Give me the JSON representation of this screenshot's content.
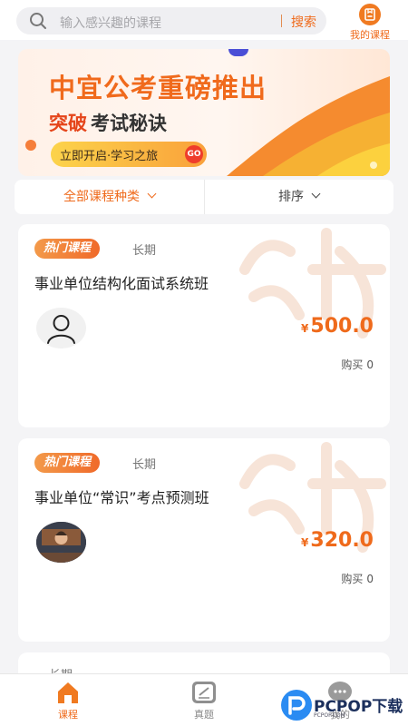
{
  "search": {
    "placeholder": "输入感兴趣的课程",
    "button_label": "搜索"
  },
  "my_courses": {
    "label": "我的课程",
    "icon": "bookmark-icon"
  },
  "banner": {
    "title": "中宜公考重磅推出",
    "subtitle_highlight": "突破",
    "subtitle_rest": "考试秘诀",
    "cta_label": "立即开启·学习之旅",
    "go_label": "GO"
  },
  "filters": {
    "category_label": "全部课程种类",
    "sort_label": "排序"
  },
  "courses": [
    {
      "tag": "热门课程",
      "duration": "长期",
      "title": "事业单位结构化面试系统班",
      "currency": "¥",
      "price": "500.0",
      "buy_label": "购买",
      "buy_count": "0"
    },
    {
      "tag": "热门课程",
      "duration": "长期",
      "title": "事业单位“常识”考点预测班",
      "currency": "¥",
      "price": "320.0",
      "buy_label": "购买",
      "buy_count": "0"
    },
    {
      "duration": "长期"
    }
  ],
  "bottom_nav": [
    {
      "label": "课程",
      "icon": "home-icon",
      "active": true
    },
    {
      "label": "真题",
      "icon": "edit-icon",
      "active": false
    },
    {
      "label": "我的",
      "icon": "chat-icon",
      "active": false
    }
  ],
  "watermark": {
    "text": "PCPOP下载",
    "sub": "PCPOP.COM"
  },
  "colors": {
    "accent": "#ef6a1b",
    "background": "#f4f4f6"
  }
}
